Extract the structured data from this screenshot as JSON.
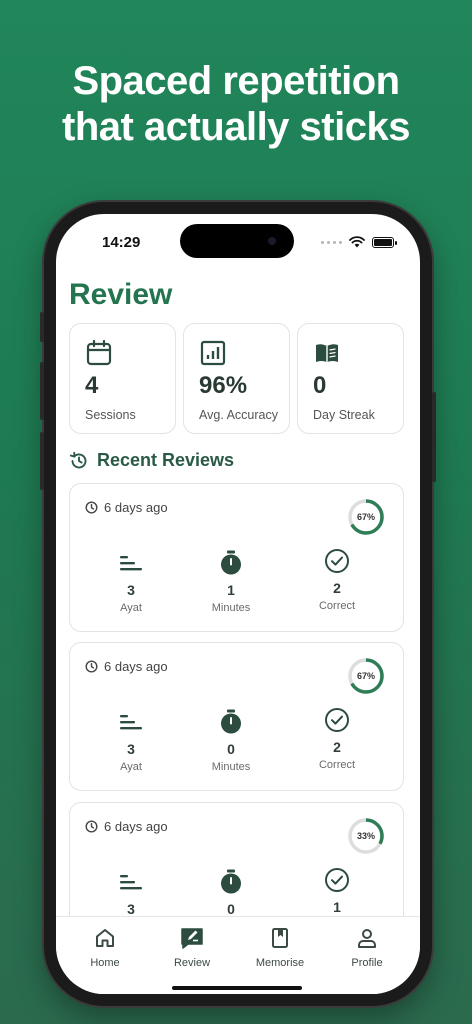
{
  "headline": {
    "line1": "Spaced repetition",
    "line2": "that actually sticks"
  },
  "status_bar": {
    "time": "14:29"
  },
  "page": {
    "title": "Review"
  },
  "stats": [
    {
      "icon": "calendar-icon",
      "value": "4",
      "label": "Sessions"
    },
    {
      "icon": "chart-icon",
      "value": "96%",
      "label": "Avg. Accuracy"
    },
    {
      "icon": "book-icon",
      "value": "0",
      "label": "Day Streak"
    }
  ],
  "section": {
    "title": "Recent Reviews",
    "icon": "history-icon"
  },
  "reviews": [
    {
      "when": "6 days ago",
      "percent_label": "67%",
      "percent": 0.67,
      "ayat": "3",
      "minutes": "1",
      "correct": "2"
    },
    {
      "when": "6 days ago",
      "percent_label": "67%",
      "percent": 0.67,
      "ayat": "3",
      "minutes": "0",
      "correct": "2"
    },
    {
      "when": "6 days ago",
      "percent_label": "33%",
      "percent": 0.33,
      "ayat": "3",
      "minutes": "0",
      "correct": "1"
    }
  ],
  "metric_labels": {
    "ayat": "Ayat",
    "minutes": "Minutes",
    "correct": "Correct"
  },
  "tabs": [
    {
      "label": "Home",
      "icon": "home-icon"
    },
    {
      "label": "Review",
      "icon": "review-icon"
    },
    {
      "label": "Memorise",
      "icon": "bookmark-icon"
    },
    {
      "label": "Profile",
      "icon": "profile-icon"
    }
  ],
  "colors": {
    "accent": "#24754f",
    "ring": "#2e7d57",
    "ring_track": "#dddddd",
    "bg_top": "#21865a",
    "bg_bottom": "#2b6a4d"
  }
}
